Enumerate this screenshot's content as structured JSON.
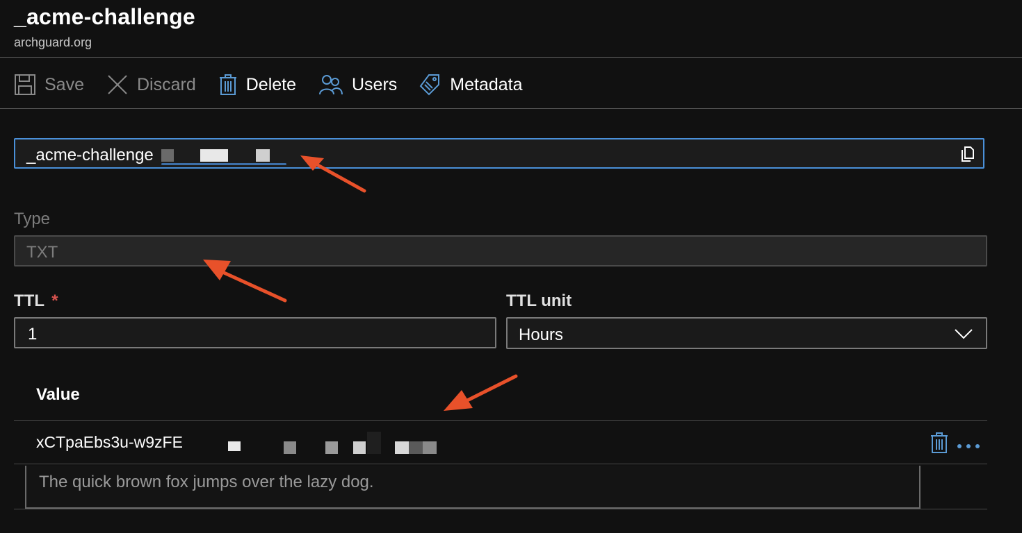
{
  "header": {
    "title": "_acme-challenge",
    "subtitle": "archguard.org"
  },
  "toolbar": {
    "save_label": "Save",
    "discard_label": "Discard",
    "delete_label": "Delete",
    "users_label": "Users",
    "metadata_label": "Metadata"
  },
  "record": {
    "name_value": "_acme-challenge",
    "type_label": "Type",
    "type_value": "TXT",
    "ttl_label": "TTL",
    "ttl_required_mark": "*",
    "ttl_value": "1",
    "ttl_unit_label": "TTL unit",
    "ttl_unit_value": "Hours"
  },
  "values": {
    "header": "Value",
    "rows": [
      {
        "value": "xCTpaEbs3u-w9zFE"
      }
    ],
    "new_value_placeholder": "The quick brown fox jumps over the lazy dog."
  },
  "colors": {
    "accent": "#4a90d9",
    "annotation_arrow": "#e8512a",
    "required": "#d9534f",
    "icon_blue": "#5b9bd5"
  },
  "icons": [
    "save-icon",
    "discard-icon",
    "delete-icon",
    "users-icon",
    "metadata-icon",
    "copy-icon",
    "chevron-down-icon",
    "trash-icon",
    "more-icon"
  ]
}
